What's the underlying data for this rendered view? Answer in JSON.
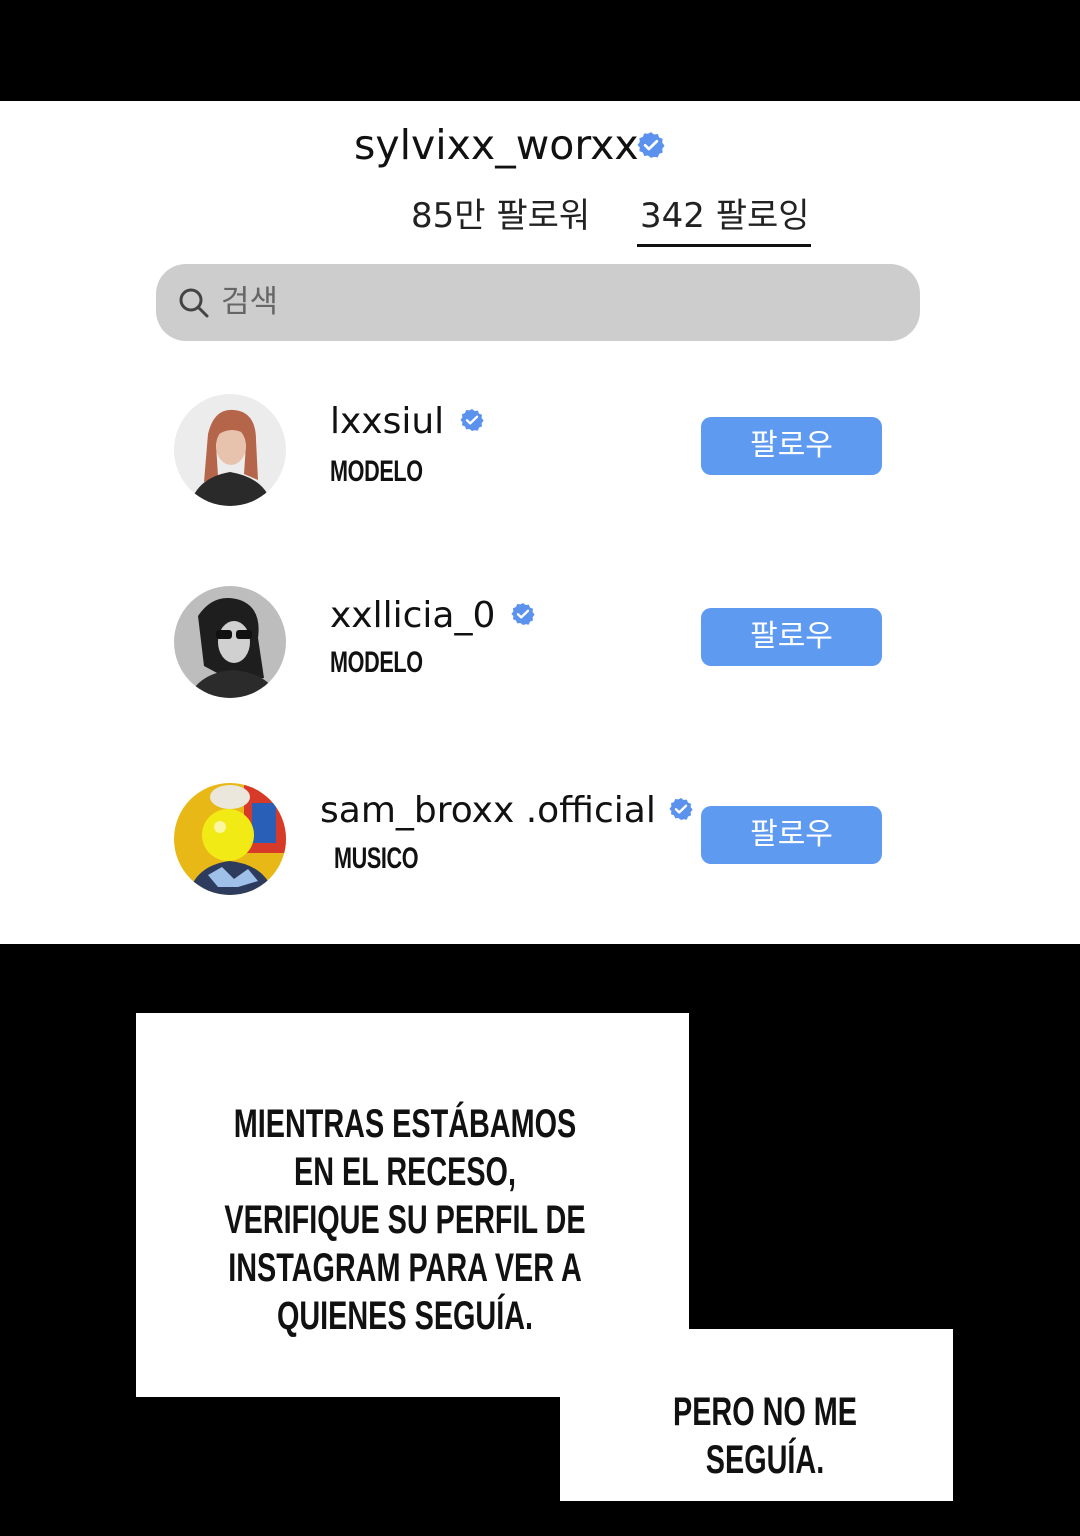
{
  "profile": {
    "username": "sylvixx_worxx"
  },
  "tabs": [
    {
      "label": "85만 팔로워"
    },
    {
      "label": "342 팔로잉"
    }
  ],
  "search": {
    "placeholder": "검색"
  },
  "following": [
    {
      "username": "lxxsiul",
      "role": "MODELO",
      "button": "팔로우"
    },
    {
      "username": "xxllicia_0",
      "role": "MODELO",
      "button": "팔로우"
    },
    {
      "username": "sam_broxx .official",
      "role": "MUSICO",
      "button": "팔로우"
    }
  ],
  "captions": {
    "first": "MIENTRAS ESTÁBAMOS EN EL RECESO, VERIFIQUE SU PERFIL DE INSTAGRAM PARA VER A QUIENES SEGUÍA.",
    "second": "PERO NO ME SEGUÍA."
  },
  "colors": {
    "verified": "#5b92ee",
    "button": "#5e9af0",
    "search_bg": "#cdcdcd"
  }
}
